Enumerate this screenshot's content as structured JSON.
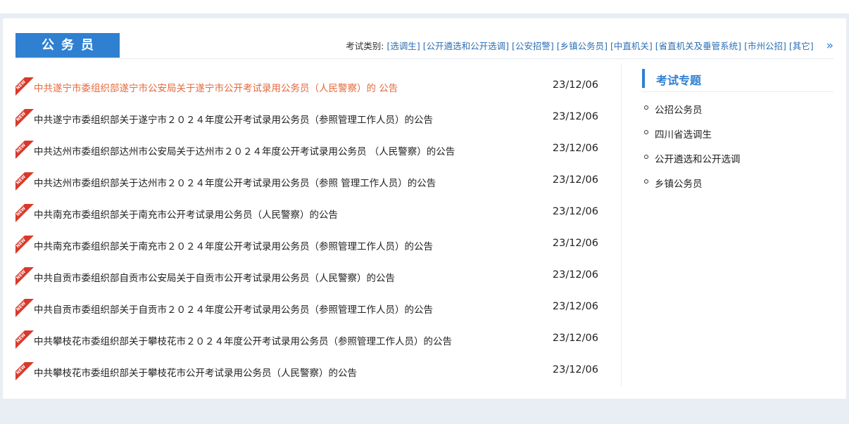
{
  "section": {
    "title": "公务员",
    "filter_label": "考试类别:",
    "filters": [
      "[选调生]",
      "[公开遴选和公开选调]",
      "[公安招警]",
      "[乡镇公务员]",
      "[中直机关]",
      "[省直机关及垂管系统]",
      "[市州公招]",
      "[其它]"
    ],
    "more_symbol": "»"
  },
  "news": [
    {
      "title": "中共遂宁市委组织部遂宁市公安局关于遂宁市公开考试录用公务员（人民警察）的 公告",
      "date": "23/12/06"
    },
    {
      "title": "中共遂宁市委组织部关于遂宁市２０２４年度公开考试录用公务员（参照管理工作人员）的公告",
      "date": "23/12/06"
    },
    {
      "title": "中共达州市委组织部达州市公安局关于达州市２０２４年度公开考试录用公务员 （人民警察）的公告",
      "date": "23/12/06"
    },
    {
      "title": "中共达州市委组织部关于达州市２０２４年度公开考试录用公务员（参照 管理工作人员）的公告",
      "date": "23/12/06"
    },
    {
      "title": "中共南充市委组织部关于南充市公开考试录用公务员（人民警察）的公告",
      "date": "23/12/06"
    },
    {
      "title": "中共南充市委组织部关于南充市２０２４年度公开考试录用公务员（参照管理工作人员）的公告",
      "date": "23/12/06"
    },
    {
      "title": "中共自贡市委组织部自贡市公安局关于自贡市公开考试录用公务员（人民警察）的公告",
      "date": "23/12/06"
    },
    {
      "title": "中共自贡市委组织部关于自贡市２０２４年度公开考试录用公务员（参照管理工作人员）的公告",
      "date": "23/12/06"
    },
    {
      "title": "中共攀枝花市委组织部关于攀枝花市２０２４年度公开考试录用公务员（参照管理工作人员）的公告",
      "date": "23/12/06"
    },
    {
      "title": "中共攀枝花市委组织部关于攀枝花市公开考试录用公务员（人民警察）的公告",
      "date": "23/12/06"
    }
  ],
  "sidebar": {
    "title": "考试专题",
    "items": [
      "公招公务员",
      "四川省选调生",
      "公开遴选和公开选调",
      "乡镇公务员"
    ]
  },
  "badge": {
    "label": "NEW",
    "color": "#d9392b"
  },
  "colors": {
    "accent": "#2f80d1",
    "link": "#2d6fb3",
    "hot": "#e46a3c"
  }
}
